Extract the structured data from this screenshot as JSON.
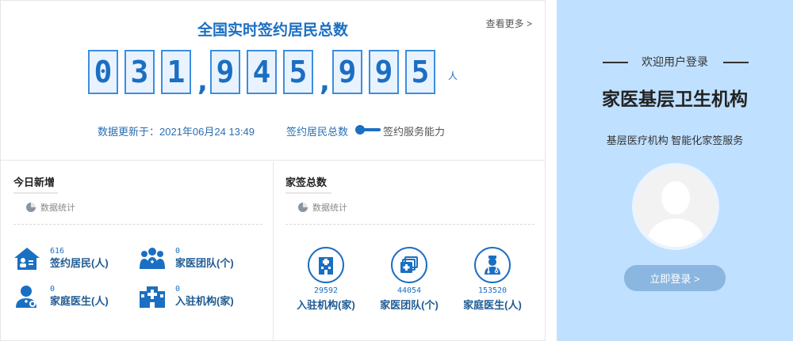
{
  "header": {
    "title": "全国实时签约居民总数",
    "more_link": "查看更多 >"
  },
  "counter": {
    "digits": [
      "0",
      "3",
      "1",
      "9",
      "4",
      "5",
      "9",
      "9",
      "5"
    ],
    "separator": ",",
    "unit": "人"
  },
  "update": {
    "text": "数据更新于：2021年06月24 13:49",
    "toggle_left": "签约居民总数",
    "toggle_right": "签约服务能力"
  },
  "today": {
    "title": "今日新增",
    "stat_label": "数据统计",
    "items": [
      {
        "value": "616",
        "label": "签约居民(人)",
        "icon": "house-person-icon"
      },
      {
        "value": "0",
        "label": "家医团队(个)",
        "icon": "team-icon"
      },
      {
        "value": "0",
        "label": "家庭医生(人)",
        "icon": "doctor-icon"
      },
      {
        "value": "0",
        "label": "入驻机构(家)",
        "icon": "hospital-icon"
      }
    ]
  },
  "total": {
    "title": "家签总数",
    "stat_label": "数据统计",
    "items": [
      {
        "value": "29592",
        "label": "入驻机构(家)",
        "icon": "building-icon"
      },
      {
        "value": "44054",
        "label": "家医团队(个)",
        "icon": "medical-folder-icon"
      },
      {
        "value": "153520",
        "label": "家庭医生(人)",
        "icon": "doctor-stethoscope-icon"
      }
    ]
  },
  "login": {
    "welcome": "欢迎用户登录",
    "org_title": "家医基层卫生机构",
    "description": "基层医疗机构 智能化家签服务",
    "button": "立即登录 >"
  },
  "colors": {
    "primary": "#1b6fc2",
    "login_bg": "#bfe0ff",
    "button_bg": "#8ab6e0"
  }
}
